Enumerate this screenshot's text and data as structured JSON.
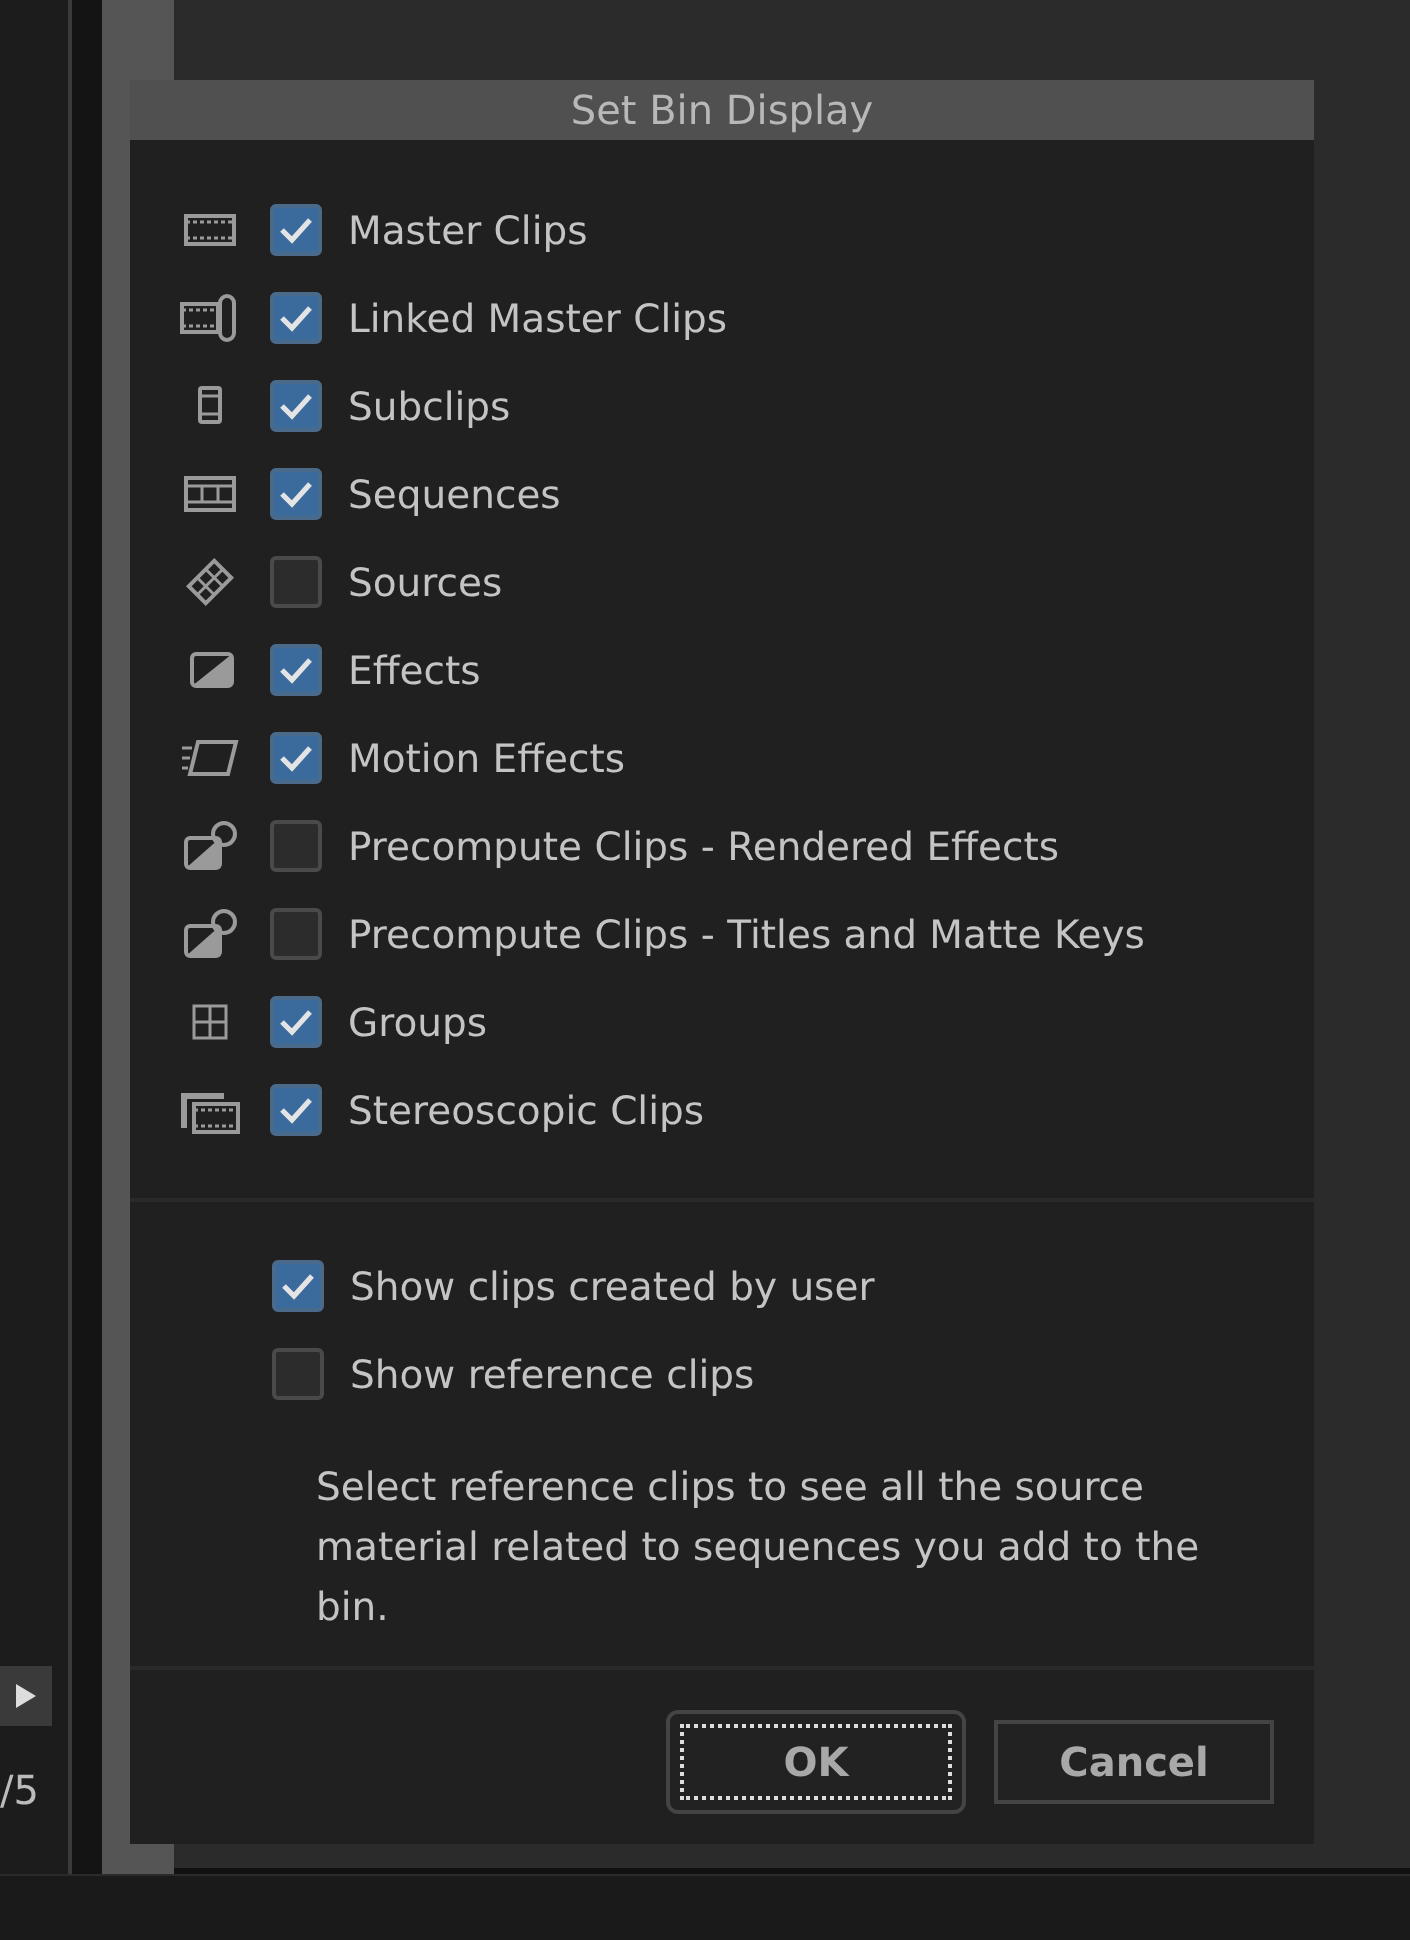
{
  "background": {
    "counter": "/5"
  },
  "dialog": {
    "title": "Set Bin Display",
    "items": [
      {
        "label": "Master Clips",
        "checked": true
      },
      {
        "label": "Linked Master Clips",
        "checked": true
      },
      {
        "label": "Subclips",
        "checked": true
      },
      {
        "label": "Sequences",
        "checked": true
      },
      {
        "label": "Sources",
        "checked": false
      },
      {
        "label": "Effects",
        "checked": true
      },
      {
        "label": "Motion Effects",
        "checked": true
      },
      {
        "label": "Precompute Clips - Rendered Effects",
        "checked": false
      },
      {
        "label": "Precompute Clips - Titles and Matte Keys",
        "checked": false
      },
      {
        "label": "Groups",
        "checked": true
      },
      {
        "label": "Stereoscopic Clips",
        "checked": true
      }
    ],
    "options": [
      {
        "label": "Show clips created by user",
        "checked": true
      },
      {
        "label": "Show reference clips",
        "checked": false
      }
    ],
    "description": "Select reference clips to see all the source material related to sequences you add to the bin.",
    "buttons": [
      {
        "label": "OK",
        "focused": true
      },
      {
        "label": "Cancel",
        "focused": false
      }
    ]
  }
}
